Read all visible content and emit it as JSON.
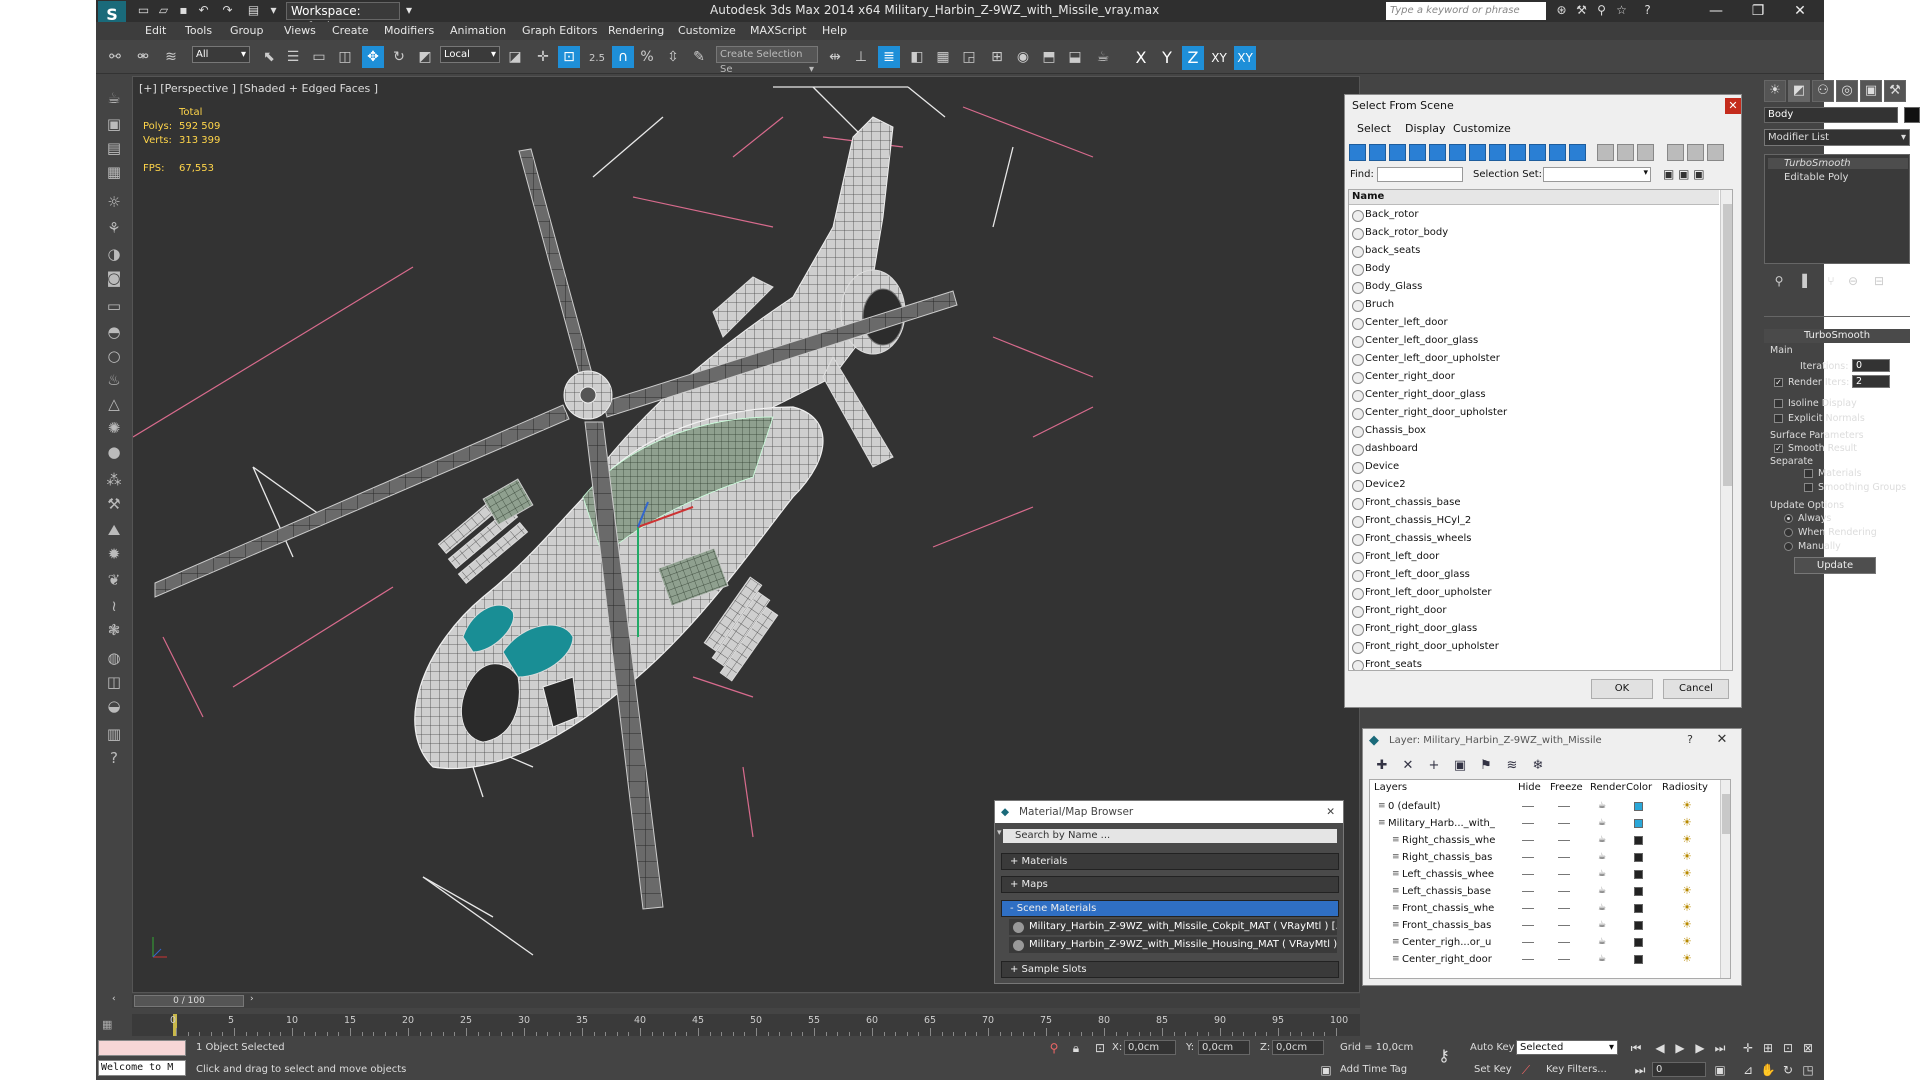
{
  "app": {
    "title": "Autodesk 3ds Max  2014 x64     Military_Harbin_Z-9WZ_with_Missile_vray.max",
    "workspace": "Workspace: Default",
    "search_placeholder": "Type a keyword or phrase"
  },
  "menu": [
    "Edit",
    "Tools",
    "Group",
    "Views",
    "Create",
    "Modifiers",
    "Animation",
    "Graph Editors",
    "Rendering",
    "Customize",
    "MAXScript",
    "Help"
  ],
  "toolbar": {
    "filter": "All",
    "coord": "Local",
    "snap_angle": "2.5",
    "selection_set": "Create Selection Se",
    "axes": [
      "X",
      "Y",
      "Z",
      "XY",
      "XY"
    ]
  },
  "viewport": {
    "label": "[+] [Perspective ] [Shaded + Edged Faces ]",
    "stats": {
      "total_label": "Total",
      "polys_label": "Polys:",
      "polys": "592 509",
      "verts_label": "Verts:",
      "verts": "313 399",
      "fps_label": "FPS:",
      "fps": "67,553"
    }
  },
  "select_from_scene": {
    "title": "Select From Scene",
    "menus": [
      "Select",
      "Display",
      "Customize"
    ],
    "find_label": "Find:",
    "selection_set_label": "Selection Set:",
    "column_name": "Name",
    "items": [
      "Back_rotor",
      "Back_rotor_body",
      "back_seats",
      "Body",
      "Body_Glass",
      "Bruch",
      "Center_left_door",
      "Center_left_door_glass",
      "Center_left_door_upholster",
      "Center_right_door",
      "Center_right_door_glass",
      "Center_right_door_upholster",
      "Chassis_box",
      "dashboard",
      "Device",
      "Device2",
      "Front_chassis_base",
      "Front_chassis_HCyl_2",
      "Front_chassis_wheels",
      "Front_left_door",
      "Front_left_door_glass",
      "Front_left_door_upholster",
      "Front_right_door",
      "Front_right_door_glass",
      "Front_right_door_upholster",
      "Front_seats"
    ],
    "ok": "OK",
    "cancel": "Cancel"
  },
  "layer_dialog": {
    "title": "Layer: Military_Harbin_Z-9WZ_with_Missile",
    "columns": [
      "Layers",
      "Hide",
      "Freeze",
      "Render",
      "Color",
      "Radiosity"
    ],
    "rows": [
      {
        "name": "0 (default)",
        "indent": 0,
        "color": "#2aa7d8"
      },
      {
        "name": "Military_Harb..._with_",
        "indent": 0,
        "color": "#2aa7d8"
      },
      {
        "name": "Right_chassis_whe",
        "indent": 1,
        "color": "#222222"
      },
      {
        "name": "Right_chassis_bas",
        "indent": 1,
        "color": "#222222"
      },
      {
        "name": "Left_chassis_whee",
        "indent": 1,
        "color": "#222222"
      },
      {
        "name": "Left_chassis_base",
        "indent": 1,
        "color": "#222222"
      },
      {
        "name": "Front_chassis_whe",
        "indent": 1,
        "color": "#222222"
      },
      {
        "name": "Front_chassis_bas",
        "indent": 1,
        "color": "#222222"
      },
      {
        "name": "Center_righ...or_u",
        "indent": 1,
        "color": "#222222"
      },
      {
        "name": "Center_right_door",
        "indent": 1,
        "color": "#222222"
      }
    ]
  },
  "material_browser": {
    "title": "Material/Map Browser",
    "search_placeholder": "Search by Name ...",
    "groups": [
      "+ Materials",
      "+ Maps",
      "- Scene Materials",
      "+ Sample Slots"
    ],
    "scene_materials": [
      "Military_Harbin_Z-9WZ_with_Missile_Cokpit_MAT ( VRayMtl ) [...",
      "Military_Harbin_Z-9WZ_with_Missile_Housing_MAT ( VRayMtl ) ..."
    ]
  },
  "command_panel": {
    "object_name": "Body",
    "modifier_list": "Modifier List",
    "stack": [
      "TurboSmooth",
      "Editable Poly"
    ],
    "rollout_title": "TurboSmooth",
    "main_label": "Main",
    "iterations_label": "Iterations:",
    "iterations": "0",
    "render_iters_label": "Render Iters:",
    "render_iters": "2",
    "isoline": "Isoline Display",
    "explicit_normals": "Explicit Normals",
    "surface_params": "Surface Parameters",
    "smooth_result": "Smooth Result",
    "separate": "Separate",
    "materials": "Materials",
    "smoothing_groups": "Smoothing Groups",
    "update_options": "Update Options",
    "always": "Always",
    "when_rendering": "When Rendering",
    "manually": "Manually",
    "update_button": "Update"
  },
  "timeline": {
    "slider": "0 / 100",
    "ticks": [
      "0",
      "5",
      "10",
      "15",
      "20",
      "25",
      "30",
      "35",
      "40",
      "45",
      "50",
      "55",
      "60",
      "65",
      "70",
      "75",
      "80",
      "85",
      "90",
      "95",
      "100"
    ]
  },
  "status": {
    "maxscript": "Welcome to M",
    "selected": "1 Object Selected",
    "prompt": "Click and drag to select and move objects",
    "x_label": "X:",
    "x": "0,0cm",
    "y_label": "Y:",
    "y": "0,0cm",
    "z_label": "Z:",
    "z": "0,0cm",
    "grid": "Grid = 10,0cm",
    "add_time_tag": "Add Time Tag",
    "auto_key": "Auto Key",
    "set_key": "Set Key",
    "key_mode": "Selected",
    "key_filters": "Key Filters...",
    "frame": "0"
  }
}
